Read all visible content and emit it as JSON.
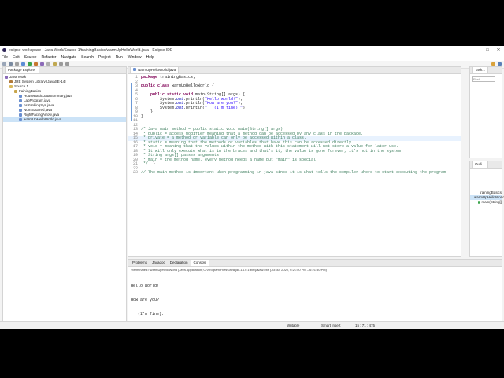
{
  "window": {
    "title": "eclipse-workspace - Java Work/Source 1/trainingBasics/warmUpHelloWorld.java - Eclipse IDE",
    "menu": [
      "File",
      "Edit",
      "Source",
      "Refactor",
      "Navigate",
      "Search",
      "Project",
      "Run",
      "Window",
      "Help"
    ]
  },
  "explorer": {
    "tab": "Package Explorer",
    "items": [
      {
        "label": "Java Work",
        "indent": 0,
        "icon": "project-icon"
      },
      {
        "label": "JRE System Library [JavaSE-14]",
        "indent": 1,
        "icon": "library-icon"
      },
      {
        "label": "Source 1",
        "indent": 1,
        "icon": "folder-icon"
      },
      {
        "label": "trainingBasics",
        "indent": 2,
        "icon": "package-icon"
      },
      {
        "label": "HouseBasicDataSummary.java",
        "indent": 3,
        "icon": "java-file-icon"
      },
      {
        "label": "LabProgram.java",
        "indent": 3,
        "icon": "java-file-icon"
      },
      {
        "label": "nsRankingSys.java",
        "indent": 3,
        "icon": "java-file-icon"
      },
      {
        "label": "NumSquared.java",
        "indent": 3,
        "icon": "java-file-icon"
      },
      {
        "label": "RightFacingArrow.java",
        "indent": 3,
        "icon": "java-file-icon"
      },
      {
        "label": "warmUpHelloWorld.java",
        "indent": 3,
        "icon": "java-file-icon",
        "selected": true
      }
    ]
  },
  "editor": {
    "tab": "warmUpHelloWorld.java",
    "lines": [
      {
        "n": "1",
        "html": "<span class='kw'>package</span> trainingBasics;"
      },
      {
        "n": "2",
        "html": ""
      },
      {
        "n": "3",
        "html": "<span class='kw'>public class</span> warmUpHelloWorld {"
      },
      {
        "n": "4",
        "html": ""
      },
      {
        "n": "5",
        "html": "    <span class='kw'>public static void</span> main(String[] args) {"
      },
      {
        "n": "6",
        "html": "        System.<span class='fld'>out</span>.println(<span class='str'>\"Hello world!\"</span>);"
      },
      {
        "n": "7",
        "html": "        System.<span class='fld'>out</span>.println(<span class='str'>\"How are you?\"</span>);"
      },
      {
        "n": "8",
        "html": "        System.<span class='fld'>out</span>.println(<span class='str'>\"   (I'm fine).\"</span>);"
      },
      {
        "n": "9",
        "html": "    }"
      },
      {
        "n": "10",
        "html": "}"
      },
      {
        "n": "11",
        "html": ""
      },
      {
        "n": "12",
        "html": ""
      },
      {
        "n": "13",
        "html": "<span class='cmt'>/* Java main method = public static void main(String[] args)</span>"
      },
      {
        "n": "14",
        "html": "<span class='cmt'> * public = access modifier meaning that a method can be accessed by any class in the package.</span>"
      },
      {
        "n": "15",
        "html": "<span class='cmt'> * private = a method or variable can only be accessed within a class.</span>",
        "hl": true
      },
      {
        "n": "16",
        "html": "<span class='cmt'> * static = meaning that the methods or variables that have this can be accessed directly</span>"
      },
      {
        "n": "17",
        "html": "<span class='cmt'> * void = meaning that the values within the method with this statement will not store a value for later use.</span>"
      },
      {
        "n": "18",
        "html": "<span class='cmt'> * It will only execute what is in the braces and that's it, the value is gone forever, it's not in the system.</span>"
      },
      {
        "n": "19",
        "html": "<span class='cmt'> * String args[] passes arguments.</span>"
      },
      {
        "n": "20",
        "html": "<span class='cmt'> * main = the method name, every method needs a name but \"main\" is special.</span>"
      },
      {
        "n": "21",
        "html": "<span class='cmt'> */</span>  }"
      },
      {
        "n": "22",
        "html": ""
      },
      {
        "n": "23",
        "html": "<span class='cmt'>// The main method is important when programming in java since it is what tells the compiler where to start executing the program.</span>"
      }
    ]
  },
  "bottom": {
    "tabs": [
      "Problems",
      "Javadoc",
      "Declaration",
      "Console"
    ],
    "active": "Console",
    "terminated": "<terminated> warmUpHelloWorld [Java Application] C:\\Program Files\\Java\\jdk-14.0.1\\bin\\javaw.exe (Jul 30, 2020, 6:21:50 PM – 6:21:50 PM)",
    "output": [
      "Hello world!",
      "How are you?",
      "   (I'm fine)."
    ]
  },
  "right": {
    "task_tab": "Task...",
    "find_placeholder": "Find",
    "outline_tab": "Outli...",
    "outline_items": [
      "trainingBasics",
      "warmUpHelloWorld",
      "main(String[]"
    ]
  },
  "status": {
    "writable": "Writable",
    "insert": "Smart Insert",
    "pos": "15 : 71 : 475"
  }
}
